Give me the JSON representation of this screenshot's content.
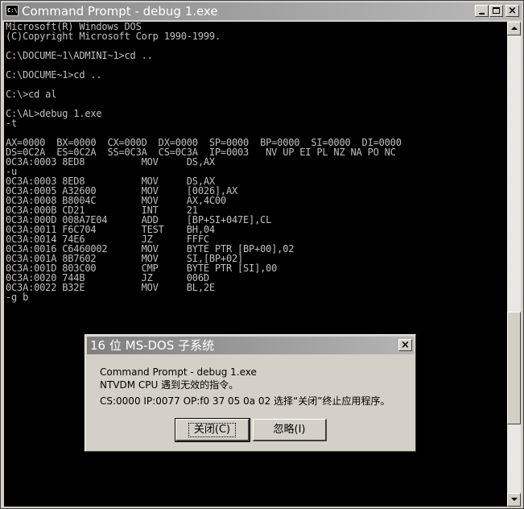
{
  "window": {
    "title": "Command Prompt - debug 1.exe",
    "icon_label": "C:\\"
  },
  "console": {
    "lines": [
      "Microsoft(R) Windows DOS",
      "(C)Copyright Microsoft Corp 1990-1999.",
      "",
      "C:\\DOCUME~1\\ADMINI~1>cd ..",
      "",
      "C:\\DOCUME~1>cd ..",
      "",
      "C:\\>cd al",
      "",
      "C:\\AL>debug 1.exe",
      "-t",
      "",
      "AX=0000  BX=0000  CX=000D  DX=0000  SP=0000  BP=0000  SI=0000  DI=0000",
      "DS=0C2A  ES=0C2A  SS=0C3A  CS=0C3A  IP=0003   NV UP EI PL NZ NA PO NC",
      "0C3A:0003 8ED8          MOV     DS,AX",
      "-u",
      "0C3A:0003 8ED8          MOV     DS,AX",
      "0C3A:0005 A32600        MOV     [0026],AX",
      "0C3A:0008 B8004C        MOV     AX,4C00",
      "0C3A:000B CD21          INT     21",
      "0C3A:000D 008A7E04      ADD     [BP+SI+047E],CL",
      "0C3A:0011 F6C704        TEST    BH,04",
      "0C3A:0014 74E6          JZ      FFFC",
      "0C3A:0016 C6460002      MOV     BYTE PTR [BP+00],02",
      "0C3A:001A 8B7602        MOV     SI,[BP+02]",
      "0C3A:001D 803C00        CMP     BYTE PTR [SI],00",
      "0C3A:0020 744B          JZ      006D",
      "0C3A:0022 B32E          MOV     BL,2E",
      "-g b"
    ]
  },
  "dialog": {
    "title": "16 位 MS-DOS 子系统",
    "line1": "Command Prompt - debug 1.exe",
    "line2": "NTVDM CPU 遇到无效的指令。",
    "line3": "CS:0000 IP:0077 OP:f0 37 05 0a 02 选择“关闭”终止应用程序。",
    "close_button": "关闭(C)",
    "ignore_button": "忽略(I)",
    "close_x": "×"
  },
  "titlebar_buttons": {
    "close_x": "×"
  }
}
